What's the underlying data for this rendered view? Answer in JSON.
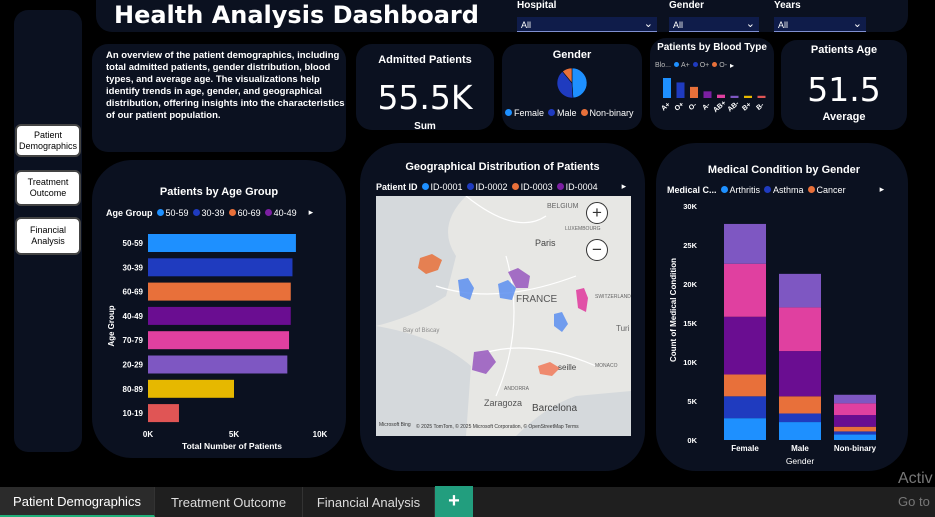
{
  "header": {
    "title": "Health Analysis Dashboard"
  },
  "slicers": [
    {
      "label": "Hospital",
      "value": "All"
    },
    {
      "label": "Gender",
      "value": "All"
    },
    {
      "label": "Years",
      "value": "All"
    }
  ],
  "nav": {
    "items": [
      "Patient Demographics",
      "Treatment Outcome",
      "Financial Analysis"
    ]
  },
  "description": "An overview of the patient demographics, including total admitted patients, gender distribution, blood types, and average age. The visualizations help identify trends in age, gender, and geographical distribution, offering insights into the characteristics of our patient population.",
  "kpis": {
    "admitted": {
      "label": "Admitted Patients",
      "value": "55.5K",
      "sub": "Sum"
    },
    "age": {
      "label": "Patients Age",
      "value": "51.5",
      "sub": "Average"
    }
  },
  "gender_card": {
    "title": "Gender",
    "legend": [
      {
        "name": "Female",
        "color": "#1e90ff"
      },
      {
        "name": "Male",
        "color": "#1f3bbf"
      },
      {
        "name": "Non-binary",
        "color": "#e8703a"
      }
    ],
    "chart_data": {
      "type": "pie",
      "categories": [
        "Female",
        "Male",
        "Non-binary"
      ],
      "values": [
        49,
        40,
        11
      ],
      "colors": [
        "#1e90ff",
        "#1f3bbf",
        "#e8703a"
      ]
    }
  },
  "blood_card": {
    "title": "Patients by Blood Type",
    "legend_prefix": "Blo...",
    "legend": [
      {
        "name": "A+",
        "color": "#1e90ff"
      },
      {
        "name": "O+",
        "color": "#1f3bbf"
      },
      {
        "name": "O-",
        "color": "#e8703a"
      }
    ],
    "chart_data": {
      "type": "bar",
      "categories": [
        "A+",
        "O+",
        "O-",
        "A-",
        "AB+",
        "AB-",
        "B+",
        "B-"
      ],
      "values": [
        18,
        14,
        10,
        6,
        3,
        2,
        2,
        2
      ],
      "colors": [
        "#1e90ff",
        "#1f3bbf",
        "#e8703a",
        "#7b1fa2",
        "#e040a0",
        "#7e57c2",
        "#e6b800",
        "#e05555"
      ]
    }
  },
  "age_group_card": {
    "title": "Patients by Age Group",
    "legend_title": "Age Group",
    "legend": [
      {
        "name": "50-59",
        "color": "#1e90ff"
      },
      {
        "name": "30-39",
        "color": "#1f3bbf"
      },
      {
        "name": "60-69",
        "color": "#e8703a"
      },
      {
        "name": "40-49",
        "color": "#7b1fa2"
      }
    ],
    "ylabel": "Age Group",
    "xlabel": "Total Number of Patients",
    "chart_data": {
      "type": "bar",
      "orientation": "horizontal",
      "categories": [
        "50-59",
        "30-39",
        "60-69",
        "40-49",
        "70-79",
        "20-29",
        "80-89",
        "10-19"
      ],
      "values": [
        8600,
        8400,
        8300,
        8300,
        8200,
        8100,
        5000,
        1800
      ],
      "colors": [
        "#1e90ff",
        "#1f3bbf",
        "#e8703a",
        "#6a0d91",
        "#e040a0",
        "#7e57c2",
        "#e6b800",
        "#e05555"
      ],
      "xlim": [
        0,
        10000
      ],
      "ticks": [
        "0K",
        "5K",
        "10K"
      ]
    }
  },
  "geo_card": {
    "title": "Geographical Distribution of Patients",
    "legend_title": "Patient ID",
    "legend": [
      {
        "name": "ID-0001",
        "color": "#1e90ff"
      },
      {
        "name": "ID-0002",
        "color": "#1f3bbf"
      },
      {
        "name": "ID-0003",
        "color": "#e8703a"
      },
      {
        "name": "ID-0004",
        "color": "#7b1fa2"
      }
    ],
    "map_labels": [
      "BELGIUM",
      "LUXEMBOURG",
      "Paris",
      "FRANCE",
      "SWITZERLAND",
      "Bay of Biscay",
      "Zaragoza",
      "Barcelona",
      "ANDORRA",
      "MONACO",
      "Turi",
      "seille"
    ],
    "attribution": "© 2025 TomTom, © 2025 Microsoft Corporation, © OpenStreetMap  Terms",
    "bing": "Microsoft Bing",
    "zoom_in": "+",
    "zoom_out": "−"
  },
  "condition_card": {
    "title": "Medical Condition by Gender",
    "legend_title": "Medical C...",
    "legend": [
      {
        "name": "Arthritis",
        "color": "#1e90ff"
      },
      {
        "name": "Asthma",
        "color": "#1f3bbf"
      },
      {
        "name": "Cancer",
        "color": "#e8703a"
      }
    ],
    "ylabel": "Count of Medical Condition",
    "xlabel": "Gender",
    "chart_data": {
      "type": "bar",
      "stacked": true,
      "categories": [
        "Female",
        "Male",
        "Non-binary"
      ],
      "ylim": [
        0,
        30000
      ],
      "ticks": [
        "0K",
        "5K",
        "10K",
        "15K",
        "20K",
        "25K",
        "30K"
      ],
      "series": [
        {
          "color": "#1e90ff",
          "values": [
            2800,
            2300,
            700
          ]
        },
        {
          "color": "#1f3bbf",
          "values": [
            2800,
            1100,
            400
          ]
        },
        {
          "color": "#e8703a",
          "values": [
            2800,
            2200,
            600
          ]
        },
        {
          "color": "#6a0d91",
          "values": [
            7400,
            5800,
            1500
          ]
        },
        {
          "color": "#e040a0",
          "values": [
            6800,
            5600,
            1500
          ]
        },
        {
          "color": "#7e57c2",
          "values": [
            5100,
            4300,
            1100
          ]
        }
      ]
    }
  },
  "tabs": [
    "Patient Demographics",
    "Treatment Outcome",
    "Financial Analysis"
  ],
  "add_tab": "+",
  "activate": {
    "line1": "Activ",
    "line2": "Go to"
  }
}
